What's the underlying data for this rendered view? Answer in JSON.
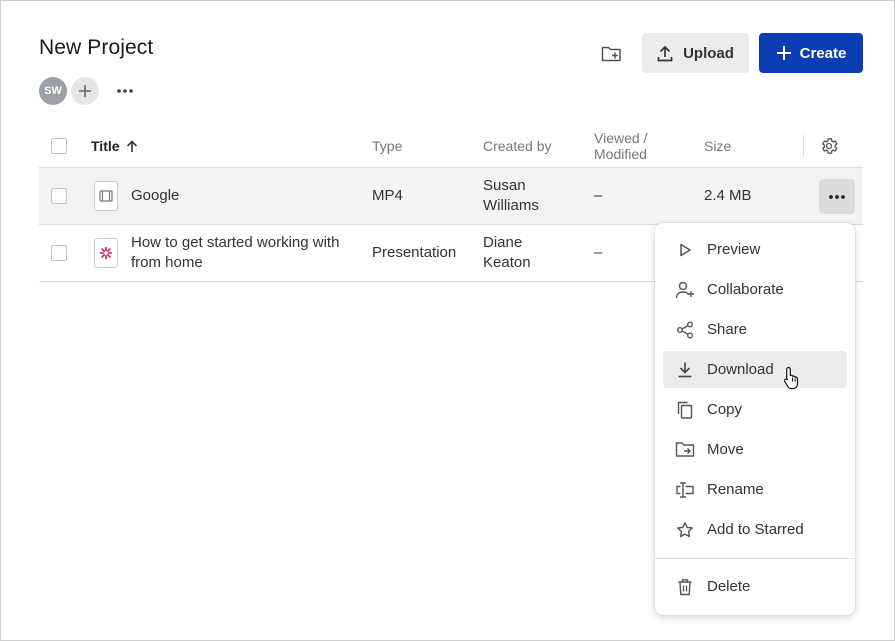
{
  "project": {
    "title": "New Project"
  },
  "members": {
    "initials": "SW"
  },
  "toolbar": {
    "upload_label": "Upload",
    "create_label": "Create"
  },
  "table": {
    "columns": {
      "title": "Title",
      "type": "Type",
      "created_by": "Created by",
      "viewed": "Viewed /",
      "modified": "Modified",
      "size": "Size"
    },
    "rows": [
      {
        "title": "Google",
        "title2": "",
        "type": "MP4",
        "creator1": "Susan",
        "creator2": "Williams",
        "viewed": "–",
        "size": "2.4 MB",
        "icon": "video-file-icon"
      },
      {
        "title": "How to get started working with",
        "title2": "from home",
        "type": "Presentation",
        "creator1": "Diane",
        "creator2": "Keaton",
        "viewed": "–",
        "size": "",
        "icon": "presentation-file-icon"
      }
    ]
  },
  "context_menu": {
    "items": [
      {
        "label": "Preview",
        "icon": "play-icon"
      },
      {
        "label": "Collaborate",
        "icon": "add-person-icon"
      },
      {
        "label": "Share",
        "icon": "share-icon"
      },
      {
        "label": "Download",
        "icon": "download-icon",
        "active": true
      },
      {
        "label": "Copy",
        "icon": "copy-icon"
      },
      {
        "label": "Move",
        "icon": "move-folder-icon"
      },
      {
        "label": "Rename",
        "icon": "rename-icon"
      },
      {
        "label": "Add to Starred",
        "icon": "star-icon"
      }
    ],
    "delete": {
      "label": "Delete",
      "icon": "trash-icon"
    }
  },
  "colors": {
    "primary": "#0b3db5",
    "secondary_button": "#ececec",
    "avatar": "#9aa0a6",
    "accent_pink": "#c2185b"
  }
}
